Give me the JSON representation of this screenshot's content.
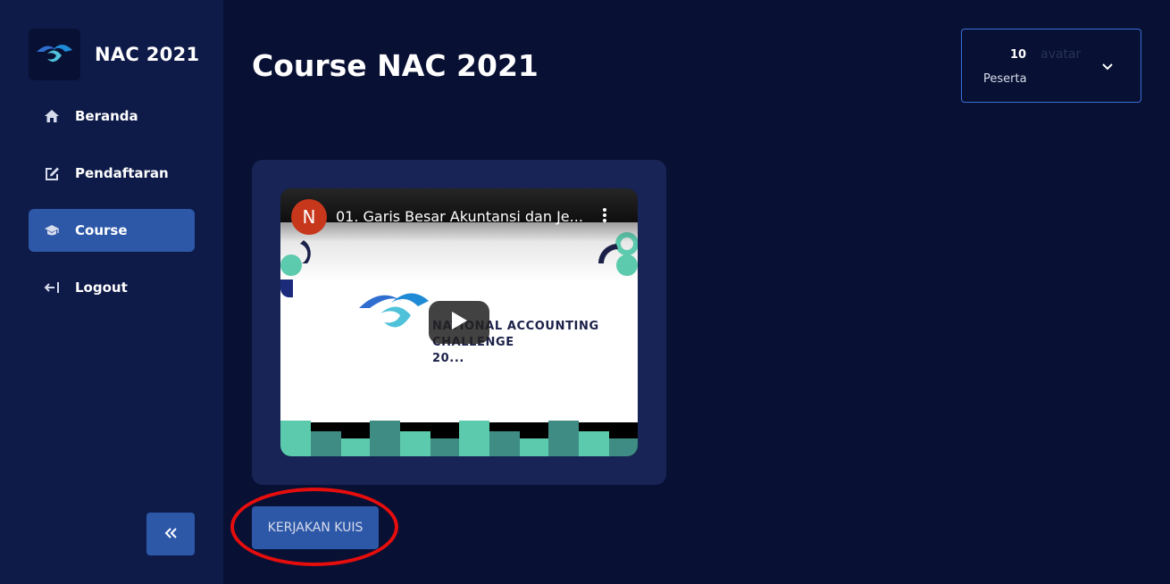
{
  "brand": {
    "name": "NAC 2021",
    "logo_icon": "nac-logo-icon"
  },
  "sidebar": {
    "items": [
      {
        "label": "Beranda",
        "icon": "home-icon"
      },
      {
        "label": "Pendaftaran",
        "icon": "edit-icon"
      },
      {
        "label": "Course",
        "icon": "graduation-cap-icon",
        "active": true
      },
      {
        "label": "Logout",
        "icon": "logout-icon"
      }
    ],
    "collapse_icon": "double-chevron-left-icon"
  },
  "header": {
    "title": "Course NAC 2021"
  },
  "profile": {
    "count": "10",
    "avatar_alt": "avatar",
    "label": "Peserta",
    "chevron_icon": "chevron-down-icon"
  },
  "video": {
    "channel_initial": "N",
    "title": "01. Garis Besar Akuntansi dan Je...",
    "thumbnail_text_line1": "NATIONAL ACCOUNTING",
    "thumbnail_text_line2": "CHALLENGE",
    "thumbnail_text_line3": "20..."
  },
  "actions": {
    "quiz_label": "KERJAKAN KUIS"
  },
  "colors": {
    "accent": "#2d58a8",
    "background": "#081033",
    "sidebar": "#0e1a48",
    "highlight": "#e60d0d"
  }
}
